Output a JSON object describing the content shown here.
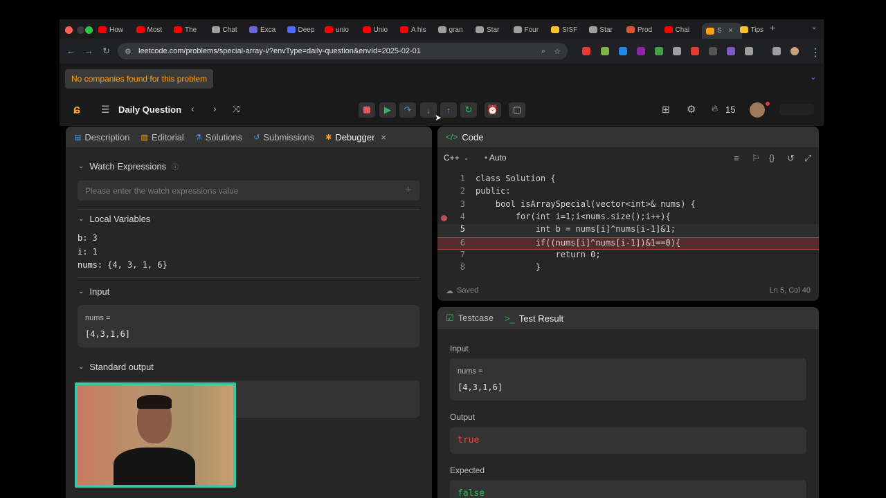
{
  "browser": {
    "tabs": [
      {
        "label": "How",
        "icon": "youtube-icon",
        "color": "#ff0000"
      },
      {
        "label": "Most",
        "icon": "youtube-icon",
        "color": "#ff0000"
      },
      {
        "label": "The",
        "icon": "youtube-icon",
        "color": "#ff0000"
      },
      {
        "label": "Chat",
        "icon": "chatgpt-icon",
        "color": "#9e9e9e"
      },
      {
        "label": "Exca",
        "icon": "excalidraw-icon",
        "color": "#6965db"
      },
      {
        "label": "Deep",
        "icon": "deepseek-icon",
        "color": "#4d6bfe"
      },
      {
        "label": "unio",
        "icon": "youtube-icon",
        "color": "#ff0000"
      },
      {
        "label": "Unio",
        "icon": "youtube-icon",
        "color": "#ff0000"
      },
      {
        "label": "A his",
        "icon": "youtube-icon",
        "color": "#ff0000"
      },
      {
        "label": "gran",
        "icon": "google-icon",
        "color": "#9e9e9e"
      },
      {
        "label": "Star",
        "icon": "page-icon",
        "color": "#9e9e9e"
      },
      {
        "label": "Four",
        "icon": "google-icon",
        "color": "#9e9e9e"
      },
      {
        "label": "SISF",
        "icon": "bulb-icon",
        "color": "#fbc02d"
      },
      {
        "label": "Star",
        "icon": "chatgpt-icon",
        "color": "#9e9e9e"
      },
      {
        "label": "Prod",
        "icon": "producthunt-icon",
        "color": "#da552f"
      },
      {
        "label": "Chai",
        "icon": "youtube-icon",
        "color": "#ff0000"
      },
      {
        "label": "S",
        "icon": "leetcode-icon",
        "color": "#ffa116",
        "active": true
      },
      {
        "label": "Tips",
        "icon": "bulb-icon",
        "color": "#fbc02d"
      }
    ],
    "url": "leetcode.com/problems/special-array-i/?envType=daily-question&envId=2025-02-01"
  },
  "company_bar": {
    "text": "No companies found for this problem"
  },
  "header": {
    "title": "Daily Question",
    "streak_count": "15"
  },
  "left_tabs": [
    {
      "label": "Description",
      "icon": "description-icon"
    },
    {
      "label": "Editorial",
      "icon": "book-icon"
    },
    {
      "label": "Solutions",
      "icon": "flask-icon"
    },
    {
      "label": "Submissions",
      "icon": "history-icon"
    },
    {
      "label": "Debugger",
      "icon": "bug-icon",
      "active": true
    }
  ],
  "debugger": {
    "watch_title": "Watch Expressions",
    "watch_placeholder": "Please enter the watch expressions value",
    "locals_title": "Local Variables",
    "locals": [
      {
        "name": "b:",
        "value": "3"
      },
      {
        "name": "i:",
        "value": "1"
      },
      {
        "name": "nums:",
        "value": "{4, 3, 1, 6}"
      }
    ],
    "input_title": "Input",
    "input_param": "nums =",
    "input_value": "[4,3,1,6]",
    "stdout_title": "Standard output"
  },
  "code": {
    "title": "Code",
    "language": "C++",
    "mode": "Auto",
    "saved": "Saved",
    "position": "Ln 5, Col 40",
    "lines": [
      {
        "n": "1",
        "text": "class Solution {"
      },
      {
        "n": "2",
        "text": "public:"
      },
      {
        "n": "3",
        "text": "    bool isArraySpecial(vector<int>& nums) {"
      },
      {
        "n": "4",
        "text": "        for(int i=1;i<nums.size();i++){"
      },
      {
        "n": "5",
        "text": "            int b = nums[i]^nums[i-1]&1;"
      },
      {
        "n": "6",
        "text": "            if((nums[i]^nums[i-1])&1==0){"
      },
      {
        "n": "7",
        "text": "                return 0;"
      },
      {
        "n": "8",
        "text": "            }"
      }
    ]
  },
  "tests": {
    "tab_testcase": "Testcase",
    "tab_result": "Test Result",
    "input_label": "Input",
    "param": "nums =",
    "input_value": "[4,3,1,6]",
    "output_label": "Output",
    "output_value": "true",
    "expected_label": "Expected",
    "expected_value": "false"
  }
}
